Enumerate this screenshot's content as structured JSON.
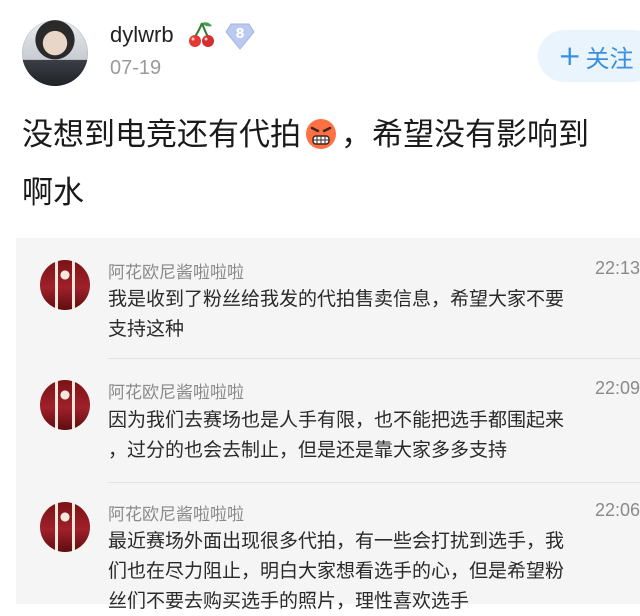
{
  "post": {
    "username": "dylwrb",
    "vip_level": "8",
    "date": "07-19",
    "follow_plus": "+",
    "follow_label": "关注",
    "text_part1": "没想到电竞还有代拍",
    "text_part2": "，希望没有影响到",
    "text_line2": "啊水",
    "icons": [
      "cherry-icon",
      "vip-diamond-icon",
      "angry-face-icon"
    ]
  },
  "comments": [
    {
      "name": "阿花欧尼酱啦啦啦",
      "time": "22:13",
      "line1": "我是收到了粉丝给我发的代拍售卖信息，希望大家不要",
      "line2": "支持这种"
    },
    {
      "name": "阿花欧尼酱啦啦啦",
      "time": "22:09",
      "line1": "因为我们去赛场也是人手有限，也不能把选手都围起来",
      "line2": "，过分的也会去制止，但是还是靠大家多多支持"
    },
    {
      "name": "阿花欧尼酱啦啦啦",
      "time": "22:06",
      "line1": "最近赛场外面出现很多代拍，有一些会打扰到选手，我",
      "line2": "们也在尽力阻止，明白大家想看选手的心，但是希望粉",
      "line3": "丝们不要去购买选手的照片，理性喜欢选手"
    }
  ],
  "colors": {
    "follow_bg": "#eaf4fd",
    "follow_text": "#3b8fe0",
    "meta_gray": "#8a8a8a",
    "card_bg": "#f5f5f5"
  }
}
